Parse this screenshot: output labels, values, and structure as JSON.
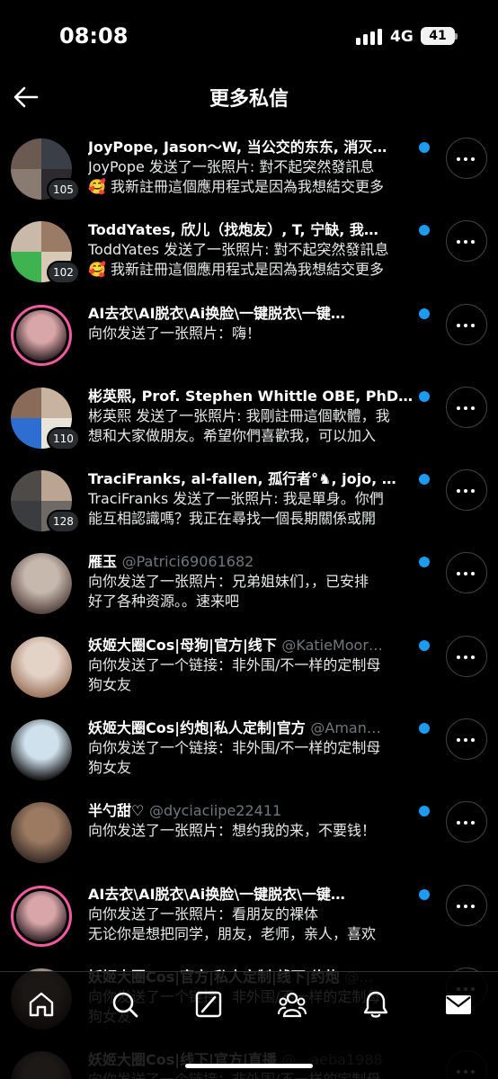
{
  "status_bar": {
    "time": "08:08",
    "network": "4G",
    "battery": "41"
  },
  "header": {
    "title": "更多私信"
  },
  "conversations": [
    {
      "title": "JoyPope, Jason～W, 当公交的东东, 消灭…",
      "handle": "",
      "lines": [
        "JoyPope 发送了一张照片: 對不起突然發訊息",
        "🥰 我新註冊這個應用程式是因為我想結交更多"
      ],
      "badge": "105",
      "unread": true,
      "avatar": {
        "type": "group",
        "colors": [
          "#6b5a52",
          "#3a3f47",
          "#8a7b70",
          "#2c2a2e"
        ]
      }
    },
    {
      "title": "ToddYates, 欣儿（找炮友）, T, 宁缺, 我…",
      "handle": "",
      "lines": [
        "ToddYates 发送了一张照片: 對不起突然發訊息",
        "🥰 我新註冊這個應用程式是因為我想結交更多"
      ],
      "badge": "102",
      "unread": true,
      "avatar": {
        "type": "group",
        "colors": [
          "#c9b9a8",
          "#9a7b66",
          "#3fb34f",
          "#d8c9b5"
        ]
      }
    },
    {
      "title": "AI去衣\\AI脱衣\\Ai换脸\\一键脱衣\\一键…",
      "handle": "",
      "lines": [
        "向你发送了一张照片：嗨！"
      ],
      "badge": "",
      "unread": true,
      "avatar": {
        "type": "ring",
        "colors": [
          "#d8a5a8",
          "#3b2a2e"
        ]
      }
    },
    {
      "title": "彬英熙, Prof. Stephen Whittle OBE, PhD…",
      "handle": "",
      "lines": [
        "彬英熙 发送了一张照片: 我剛註冊這個軟體，我",
        "想和大家做朋友。希望你們喜歡我，可以加入"
      ],
      "badge": "110",
      "unread": true,
      "avatar": {
        "type": "group",
        "colors": [
          "#8a6a58",
          "#c8b2a0",
          "#2f6ed1",
          "#e8e4da"
        ]
      }
    },
    {
      "title": "TraciFranks, al-fallen, 孤行者°♞, jojo, …",
      "handle": "",
      "lines": [
        "TraciFranks 发送了一张照片: 我是單身。你們",
        "能互相認識嗎？我正在尋找一個長期關係或開"
      ],
      "badge": "128",
      "unread": true,
      "avatar": {
        "type": "group",
        "colors": [
          "#4d4a48",
          "#b9a592",
          "#3a3c3f",
          "#6f6a66"
        ]
      }
    },
    {
      "title": "雁玉",
      "handle": "@Patrici69061682",
      "lines": [
        "向你发送了一张照片：兄弟姐妹们，，已安排",
        "好了各种资源。。速来吧"
      ],
      "badge": "",
      "unread": true,
      "avatar": {
        "type": "single",
        "colors": [
          "#c7b8ae",
          "#5a4a44"
        ]
      }
    },
    {
      "title": "妖姬大圈Cos|母狗|官方|线下",
      "handle": "@KatieMoor…",
      "lines": [
        "向你发送了一个链接：非外围/不一样的定制母",
        "狗女友"
      ],
      "badge": "",
      "unread": true,
      "avatar": {
        "type": "single",
        "colors": [
          "#e3d2c6",
          "#a07a64"
        ]
      }
    },
    {
      "title": "妖姬大圈Cos|约炮|私人定制|官方",
      "handle": "@Aman…",
      "lines": [
        "向你发送了一个链接：非外围/不一样的定制母",
        "狗女友"
      ],
      "badge": "",
      "unread": true,
      "avatar": {
        "type": "single",
        "colors": [
          "#cfe1ec",
          "#1d1d1f"
        ]
      }
    },
    {
      "title": "半勺甜♡",
      "handle": "@dyciaciipe22411",
      "lines": [
        "向你发送了一张照片：想约我的来，不要钱！"
      ],
      "badge": "",
      "unread": true,
      "avatar": {
        "type": "single",
        "colors": [
          "#9c7a62",
          "#3c2f28"
        ]
      }
    },
    {
      "title": "AI去衣\\AI脱衣\\Ai换脸\\一键脱衣\\一键…",
      "handle": "",
      "lines": [
        "向你发送了一张照片：看朋友的裸体",
        "无论你是想把同学，朋友，老师，亲人，喜欢"
      ],
      "badge": "",
      "unread": true,
      "avatar": {
        "type": "ring",
        "colors": [
          "#d8a5a8",
          "#3b2a2e"
        ]
      }
    },
    {
      "title": "妖姬大圈Cos|官方|私人定制|线下|约炮",
      "handle": "@…",
      "lines": [
        "向你发送了一个链接：非外围/不一样的定制母",
        "狗女友"
      ],
      "badge": "",
      "unread": false,
      "avatar": {
        "type": "single",
        "colors": [
          "#b9a596",
          "#5b4940"
        ]
      }
    },
    {
      "title": "妖姬大圈Cos|线下|官方|直播",
      "handle": "@…aeba1988",
      "lines": [
        "向你发送了一个链接：非外围/不一样的定制母"
      ],
      "badge": "",
      "unread": false,
      "avatar": {
        "type": "single",
        "colors": [
          "#c4b0a2",
          "#4b3c35"
        ]
      }
    }
  ],
  "bottom_nav": [
    "home-icon",
    "search-icon",
    "grok-icon",
    "communities-icon",
    "notifications-icon",
    "messages-icon"
  ],
  "colors": {
    "unread": "#1d9bf0",
    "ring": "#f25aa0",
    "background": "#000000"
  }
}
